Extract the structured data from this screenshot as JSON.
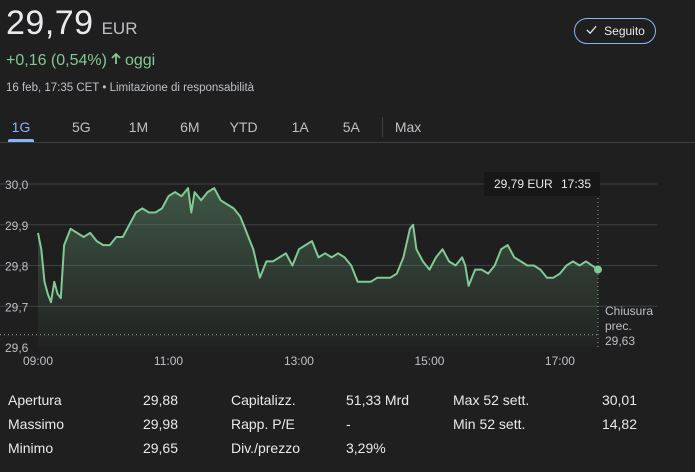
{
  "quote": {
    "price": "29,79",
    "currency": "EUR",
    "change": "+0,16 (0,54%)",
    "period": "oggi",
    "timestamp": "16 feb, 17:35 CET",
    "separator": "•",
    "disclaimer": "Limitazione di responsabilità"
  },
  "follow_button": {
    "label": "Seguito",
    "icon": "check-icon"
  },
  "tabs": [
    "1G",
    "5G",
    "1M",
    "6M",
    "YTD",
    "1A",
    "5A",
    "Max"
  ],
  "active_tab": "1G",
  "colors": {
    "background": "#1f1f1f",
    "positive": "#81c995",
    "accent": "#8ab4f8",
    "text_primary": "#e8eaed",
    "text_secondary": "#bdc1c6"
  },
  "tooltip": {
    "value": "29,79 EUR",
    "time": "17:35"
  },
  "previous_close": {
    "label_line1": "Chiusura",
    "label_line2": "prec.",
    "value": "29,63"
  },
  "stats": [
    [
      {
        "label": "Apertura",
        "value": "29,88"
      },
      {
        "label": "Capitalizz.",
        "value": "51,33 Mrd"
      },
      {
        "label": "Max 52 sett.",
        "value": "30,01"
      }
    ],
    [
      {
        "label": "Massimo",
        "value": "29,98"
      },
      {
        "label": "Rapp. P/E",
        "value": "-"
      },
      {
        "label": "Min 52 sett.",
        "value": "14,82"
      }
    ],
    [
      {
        "label": "Minimo",
        "value": "29,65"
      },
      {
        "label": "Div./prezzo",
        "value": "3,29%"
      }
    ]
  ],
  "chart_data": {
    "type": "line",
    "x_unit": "hours",
    "xlim": [
      9.0,
      17.5833
    ],
    "ylim": [
      29.6,
      30.0
    ],
    "y_ticks": [
      29.6,
      29.7,
      29.8,
      29.9,
      30.0
    ],
    "y_tick_labels": [
      "29,6",
      "29,7",
      "29,8",
      "29,9",
      "30,0"
    ],
    "x_ticks": [
      9,
      11,
      13,
      15,
      17
    ],
    "x_tick_labels": [
      "09:00",
      "11:00",
      "13:00",
      "15:00",
      "17:00"
    ],
    "grid": true,
    "reference_line": 29.63,
    "series": [
      {
        "color": "#81c995",
        "x": [
          9.0,
          9.05,
          9.1,
          9.15,
          9.2,
          9.25,
          9.3,
          9.35,
          9.4,
          9.5,
          9.6,
          9.7,
          9.8,
          9.9,
          10.0,
          10.1,
          10.2,
          10.3,
          10.4,
          10.5,
          10.6,
          10.7,
          10.8,
          10.9,
          11.0,
          11.1,
          11.2,
          11.3,
          11.35,
          11.4,
          11.5,
          11.6,
          11.7,
          11.8,
          11.9,
          12.0,
          12.1,
          12.2,
          12.25,
          12.3,
          12.4,
          12.5,
          12.6,
          12.7,
          12.8,
          12.9,
          13.0,
          13.1,
          13.2,
          13.3,
          13.4,
          13.5,
          13.6,
          13.7,
          13.8,
          13.9,
          14.0,
          14.1,
          14.2,
          14.3,
          14.4,
          14.5,
          14.6,
          14.7,
          14.75,
          14.8,
          14.9,
          15.0,
          15.1,
          15.2,
          15.3,
          15.4,
          15.5,
          15.55,
          15.6,
          15.7,
          15.8,
          15.9,
          16.0,
          16.1,
          16.2,
          16.3,
          16.4,
          16.5,
          16.6,
          16.7,
          16.8,
          16.9,
          17.0,
          17.1,
          17.2,
          17.3,
          17.4,
          17.5833
        ],
        "y": [
          29.88,
          29.84,
          29.76,
          29.73,
          29.71,
          29.76,
          29.73,
          29.72,
          29.85,
          29.89,
          29.88,
          29.87,
          29.88,
          29.86,
          29.85,
          29.85,
          29.87,
          29.87,
          29.9,
          29.93,
          29.94,
          29.93,
          29.93,
          29.94,
          29.97,
          29.98,
          29.97,
          29.99,
          29.93,
          29.98,
          29.96,
          29.98,
          29.99,
          29.96,
          29.95,
          29.94,
          29.92,
          29.88,
          29.86,
          29.84,
          29.77,
          29.81,
          29.81,
          29.82,
          29.83,
          29.8,
          29.84,
          29.85,
          29.86,
          29.82,
          29.83,
          29.82,
          29.83,
          29.82,
          29.8,
          29.76,
          29.76,
          29.76,
          29.77,
          29.77,
          29.77,
          29.78,
          29.82,
          29.89,
          29.9,
          29.84,
          29.81,
          29.79,
          29.82,
          29.84,
          29.81,
          29.8,
          29.82,
          29.8,
          29.75,
          29.79,
          29.79,
          29.78,
          29.8,
          29.84,
          29.85,
          29.82,
          29.81,
          29.8,
          29.8,
          29.79,
          29.77,
          29.77,
          29.78,
          29.8,
          29.81,
          29.8,
          29.81,
          29.79
        ]
      }
    ]
  }
}
